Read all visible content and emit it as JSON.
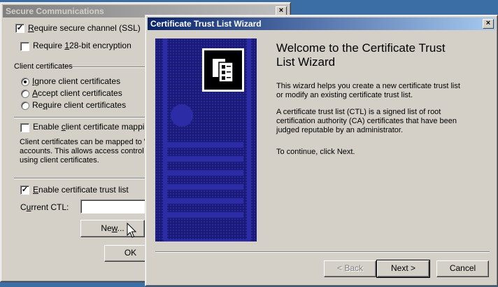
{
  "back_dialog": {
    "title": "Secure Communications",
    "close": "×",
    "require_ssl": {
      "label_pre": "",
      "label_u": "R",
      "label_post": "equire secure channel (SSL)",
      "checked": true
    },
    "require_128": {
      "label_pre": "Require ",
      "label_u": "1",
      "label_post": "28-bit encryption",
      "checked": false
    },
    "client_certs_group": "Client certificates",
    "radios": [
      {
        "pre": "",
        "u": "I",
        "post": "gnore client certificates",
        "selected": true
      },
      {
        "pre": "",
        "u": "A",
        "post": "ccept client certificates",
        "selected": false
      },
      {
        "pre": "Re",
        "u": "q",
        "post": "uire client certificates",
        "selected": false
      }
    ],
    "mapping": {
      "pre": "Enable ",
      "u": "c",
      "post": "lient certificate mapping",
      "checked": false
    },
    "mapping_desc": [
      "Client certificates can be mapped to W",
      "accounts.  This allows access control",
      "using client certificates."
    ],
    "ctl": {
      "pre": "",
      "u": "E",
      "post": "nable certificate trust list",
      "checked": true
    },
    "current_ctl_label": {
      "pre": "C",
      "u": "u",
      "post": "rrent CTL:"
    },
    "current_ctl_value": "",
    "new_button": {
      "pre": "Ne",
      "u": "w",
      "post": "..."
    },
    "ok_button": "OK"
  },
  "wizard": {
    "title": "Certificate Trust List Wizard",
    "close": "×",
    "heading_line1": "Welcome to the Certificate Trust",
    "heading_line2": "List Wizard",
    "para1": "This wizard helps you create a new certificate trust list or modify an existing certificate trust list.",
    "para2": "A certificate trust list (CTL) is a signed list of root certification authority (CA) certificates that have been judged reputable by an administrator.",
    "para3": "To continue, click Next.",
    "back_button": "< Back",
    "next_button": "Next >",
    "cancel_button": "Cancel"
  }
}
